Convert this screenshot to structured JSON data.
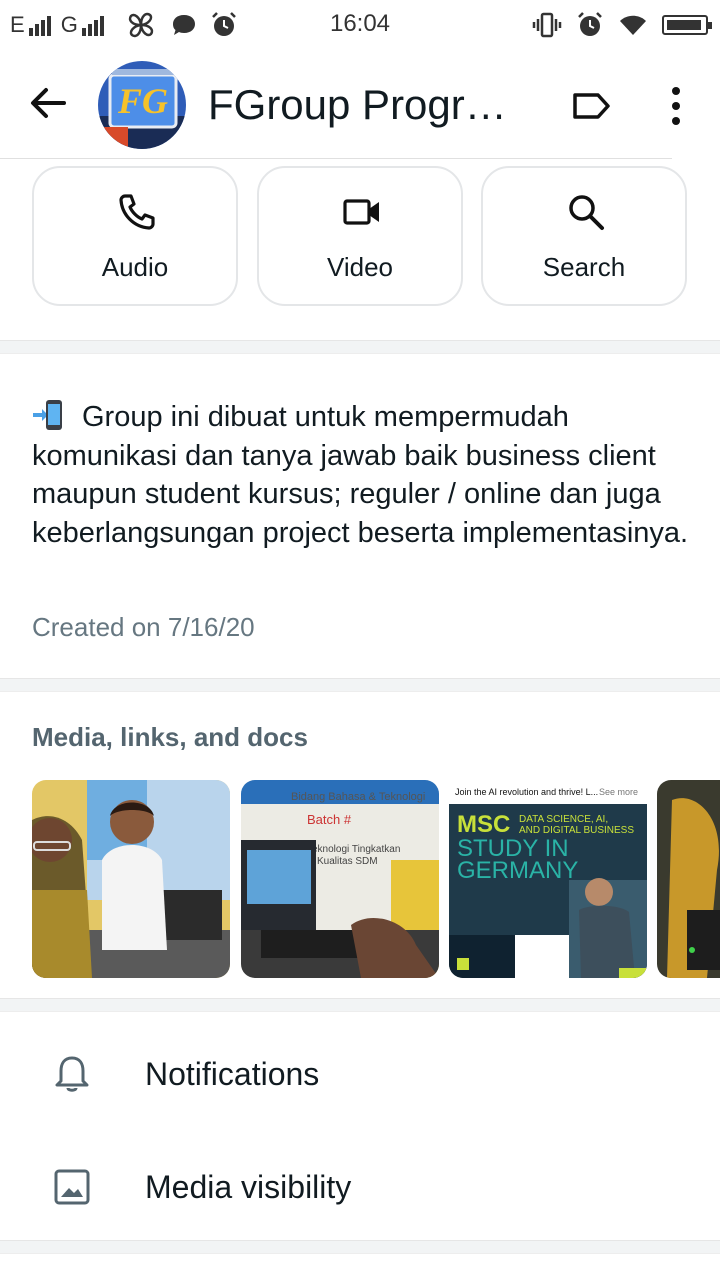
{
  "status_bar": {
    "network_1": "E",
    "network_2": "G",
    "time": "16:04",
    "battery_level": 0.95
  },
  "header": {
    "title": "FGroup Progra…",
    "avatar_text": "FG"
  },
  "actions": [
    {
      "label": "Audio",
      "icon": "phone-icon"
    },
    {
      "label": "Video",
      "icon": "video-camera-icon"
    },
    {
      "label": "Search",
      "icon": "search-icon"
    }
  ],
  "description": {
    "text": "Group ini dibuat untuk mempermudah komunikasi dan tanya jawab baik business client maupun student kursus; reguler / online dan juga keberlangsungan project beserta implementasinya.",
    "created": "Created on 7/16/20"
  },
  "media": {
    "title": "Media, links, and docs",
    "thumb2_banner": "Bidang Bahasa & Teknologi",
    "thumb2_batch": "Batch #",
    "thumb2_line1": "Teknologi Tingkatkan",
    "thumb2_line2": "Kualitas SDM",
    "ad_header": "Join the AI revolution and thrive! L...",
    "ad_see_more": "See more",
    "ad_msc": "MSC",
    "ad_sub1": "DATA SCIENCE, AI,",
    "ad_sub2": "AND DIGITAL BUSINESS",
    "ad_study": "STUDY IN",
    "ad_germany": "GERMANY"
  },
  "settings": [
    {
      "label": "Notifications",
      "icon": "bell-icon"
    },
    {
      "label": "Media visibility",
      "icon": "image-icon"
    }
  ],
  "colors": {
    "ad_bg": "#1f3a4a",
    "ad_accent": "#c8e03a",
    "ad_teal": "#2ab3a6",
    "text_secondary": "#667781"
  }
}
